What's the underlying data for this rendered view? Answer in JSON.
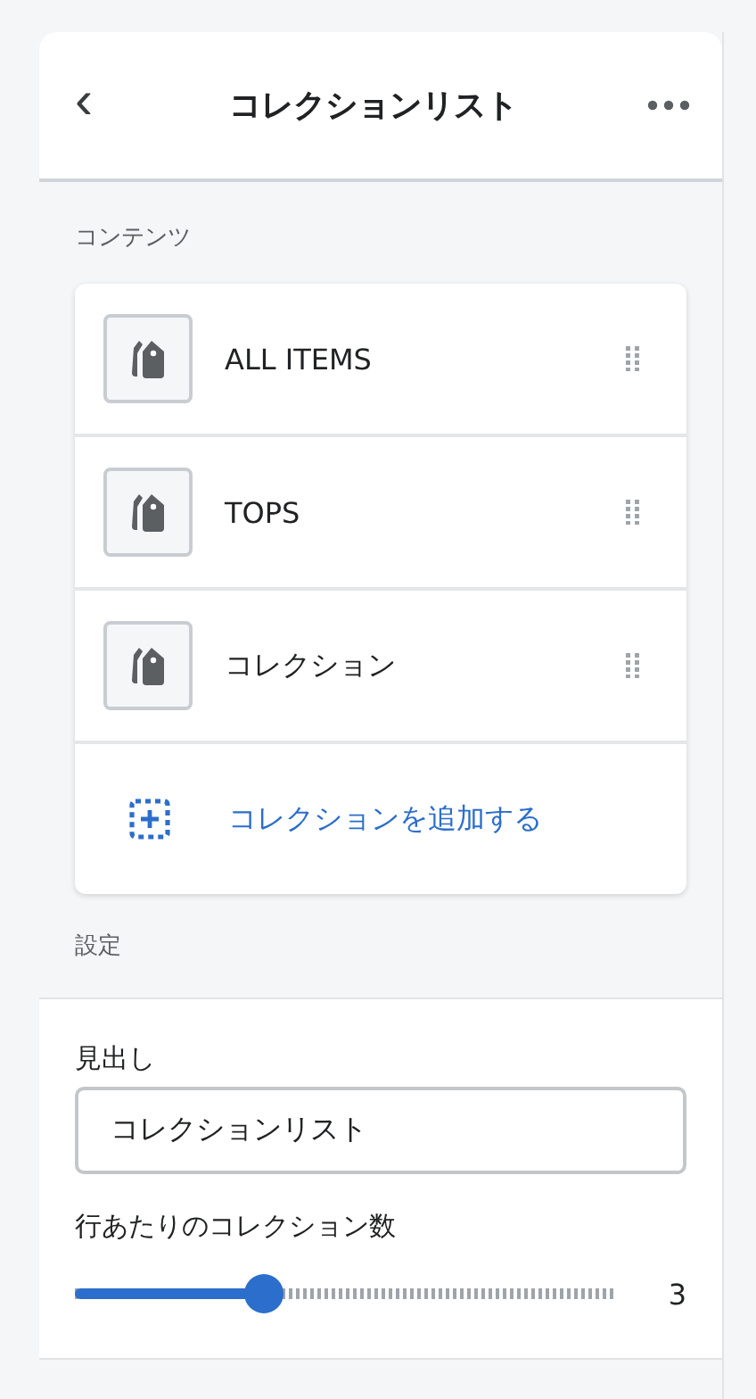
{
  "header": {
    "back_icon": "‹",
    "title": "コレクションリスト"
  },
  "contents": {
    "label": "コンテンツ",
    "items": [
      {
        "name": "ALL ITEMS"
      },
      {
        "name": "TOPS"
      },
      {
        "name": "コレクション"
      }
    ],
    "add_label": "コレクションを追加する"
  },
  "settings": {
    "label": "設定",
    "heading_label": "見出し",
    "heading_value": "コレクションリスト",
    "slider_label": "行あたりのコレクション数",
    "level": 0.35,
    "reading": "3"
  }
}
